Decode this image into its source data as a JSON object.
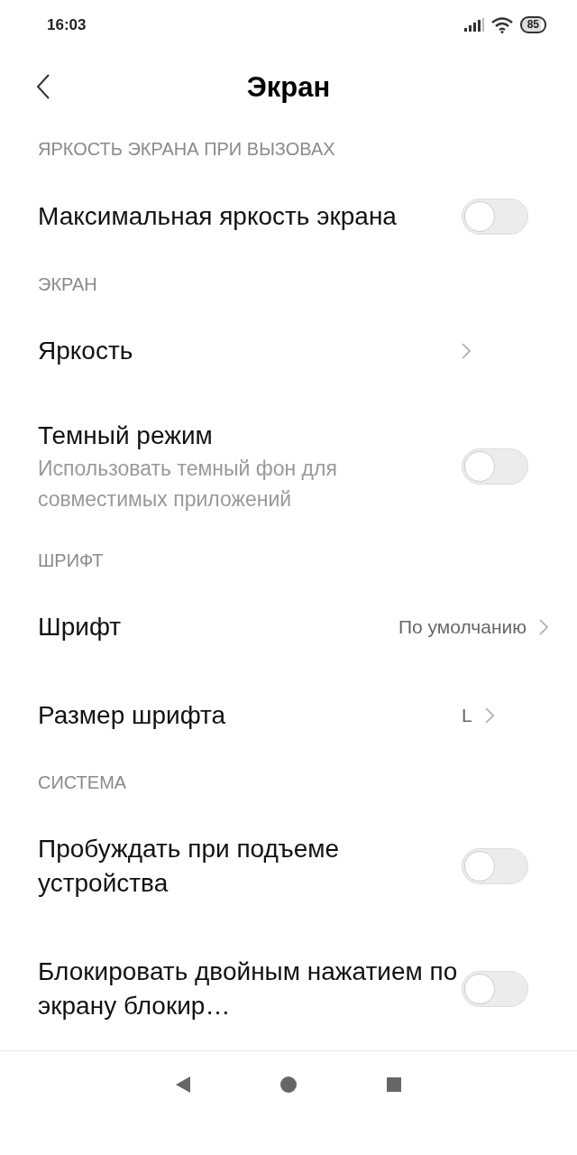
{
  "status_bar": {
    "time": "16:03",
    "battery": "85"
  },
  "header": {
    "title": "Экран"
  },
  "sections": [
    {
      "title": "ЯРКОСТЬ ЭКРАНА ПРИ ВЫЗОВАХ",
      "items": [
        {
          "kind": "toggle",
          "title": "Максимальная яркость экрана",
          "on": false
        }
      ]
    },
    {
      "title": "ЭКРАН",
      "items": [
        {
          "kind": "link",
          "title": "Яркость"
        },
        {
          "kind": "toggle",
          "title": "Темный режим",
          "subtitle": "Использовать темный фон для совместимых приложений",
          "on": false
        }
      ]
    },
    {
      "title": "ШРИФТ",
      "items": [
        {
          "kind": "link",
          "title": "Шрифт",
          "value": "По умолчанию"
        },
        {
          "kind": "link",
          "title": "Размер шрифта",
          "value": "L"
        }
      ]
    },
    {
      "title": "СИСТЕМА",
      "items": [
        {
          "kind": "toggle",
          "title": "Пробуждать при подъеме устройства",
          "on": false
        },
        {
          "kind": "toggle",
          "title": "Блокировать двойным нажатием по экрану блокир…",
          "on": false
        }
      ]
    }
  ]
}
